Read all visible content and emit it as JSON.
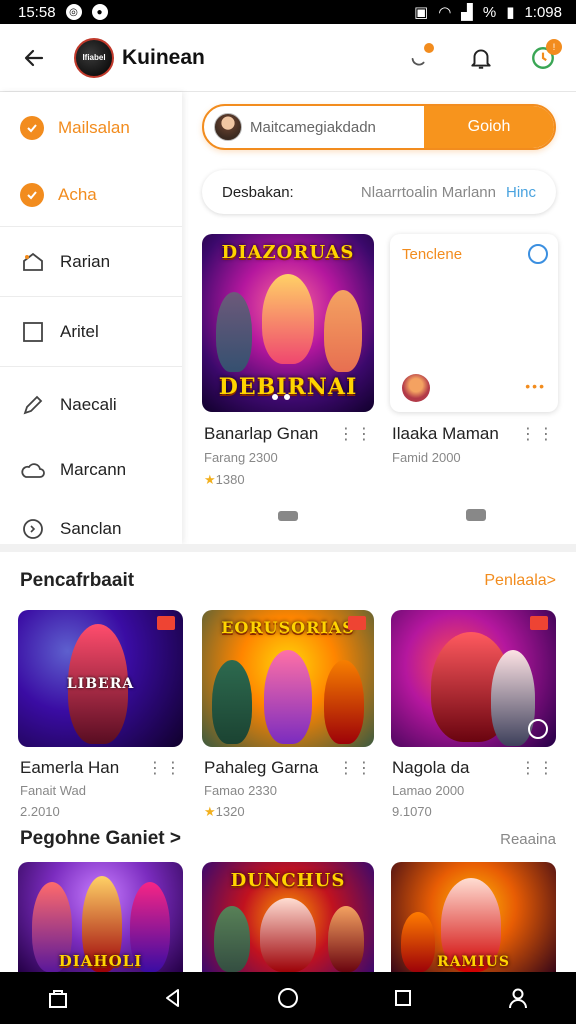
{
  "status": {
    "time": "15:58",
    "right_text": "%",
    "clock": "1:098"
  },
  "appbar": {
    "title": "Kuinean",
    "logo_text": "Ifiabel"
  },
  "sidebar": {
    "items": [
      {
        "label": "Mailsalan",
        "icon": "check-icon",
        "active": true
      },
      {
        "label": "Acha",
        "icon": "check-icon",
        "active": true
      },
      {
        "label": "Rarian",
        "icon": "home-icon",
        "active": false
      },
      {
        "label": "Aritel",
        "icon": "square-icon",
        "active": false
      },
      {
        "label": "Naecali",
        "icon": "pencil-icon",
        "active": false
      },
      {
        "label": "Marcann",
        "icon": "cloud-icon",
        "active": false
      },
      {
        "label": "Sanclan",
        "icon": "clock-icon",
        "active": false
      }
    ]
  },
  "search": {
    "placeholder": "Maitcamegiakdadn",
    "button": "Goioh"
  },
  "filter": {
    "label": "Desbakan:",
    "value": "Nlaarrtoalin Marlann",
    "hint": "Hinc"
  },
  "featured": {
    "card1": {
      "banner_top": "DIAZORUAS",
      "banner_bottom": "DEBIRNAI",
      "title": "Banarlap Gnan",
      "meta": "Farang 2300",
      "rating": "1380"
    },
    "card2": {
      "label": "Tenclene",
      "title": "Ilaaka Maman",
      "meta": "Famid 2000"
    }
  },
  "section1": {
    "heading": "Pencafrbaait",
    "action": "Penlaala>",
    "cards": [
      {
        "title": "Eamerla Han",
        "meta": "Fanait Wad",
        "rating": "2.2010",
        "starred": false,
        "banner": "LIBERA"
      },
      {
        "title": "Pahaleg Garna",
        "meta": "Famao 2330",
        "rating": "1320",
        "starred": true,
        "banner": "EORUSORIAS"
      },
      {
        "title": "Nagola da",
        "meta": "Lamao 2000",
        "rating": "9.1070",
        "starred": false,
        "banner": ""
      }
    ]
  },
  "section2": {
    "heading": "Pegohne Ganiet >",
    "action": "Reaaina",
    "cards": [
      {
        "banner": "DIAHOLI"
      },
      {
        "banner": "DUNCHUS"
      },
      {
        "banner": "RAMIUS"
      }
    ]
  },
  "colors": {
    "accent": "#f28c1e",
    "accent_button": "#f7941d",
    "link_blue": "#4aa3df"
  }
}
